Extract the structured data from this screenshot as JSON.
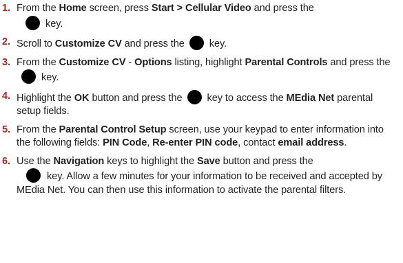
{
  "steps": [
    {
      "num": "1.",
      "t1": "From the ",
      "b1": "Home",
      "t2": " screen, press ",
      "b2": "Start > Cellular Video",
      "t3": " and press the",
      "t4": "key."
    },
    {
      "num": "2.",
      "t1": "Scroll to ",
      "b1": "Customize CV",
      "t2": " and press the",
      "t3": "key."
    },
    {
      "num": "3.",
      "t1": "From the ",
      "b1": "Customize CV",
      "t2": " - ",
      "b2": "Options",
      "t3": " listing, highlight ",
      "b3": "Parental Controls",
      "t4": " and press the",
      "t5": "key."
    },
    {
      "num": "4.",
      "t1": "Highlight the ",
      "b1": "OK",
      "t2": " button and press the",
      "t3": "key to access the ",
      "b2": "MEdia Net",
      "t4": " parental setup fields."
    },
    {
      "num": "5.",
      "t1": "From the ",
      "b1": "Parental Control Setup",
      "t2": " screen, use your keypad to enter information into the following fields: ",
      "b2": "PIN Code",
      "t3": ", ",
      "b3": "Re-enter PIN code",
      "t4": ", contact ",
      "b4": "email address",
      "t5": "."
    },
    {
      "num": "6.",
      "t1": "Use the ",
      "b1": "Navigation",
      "t2": " keys to highlight the ",
      "b2": "Save",
      "t3": " button and press the",
      "t4": "key. Allow a few minutes for your information to be received and accepted by MEdia Net. You can then use this information to activate the parental filters."
    }
  ],
  "colors": {
    "step_number": "#b5221f",
    "text": "#231f20",
    "key_icon": "#000000"
  },
  "icons": {
    "key": "filled-black-circle"
  }
}
